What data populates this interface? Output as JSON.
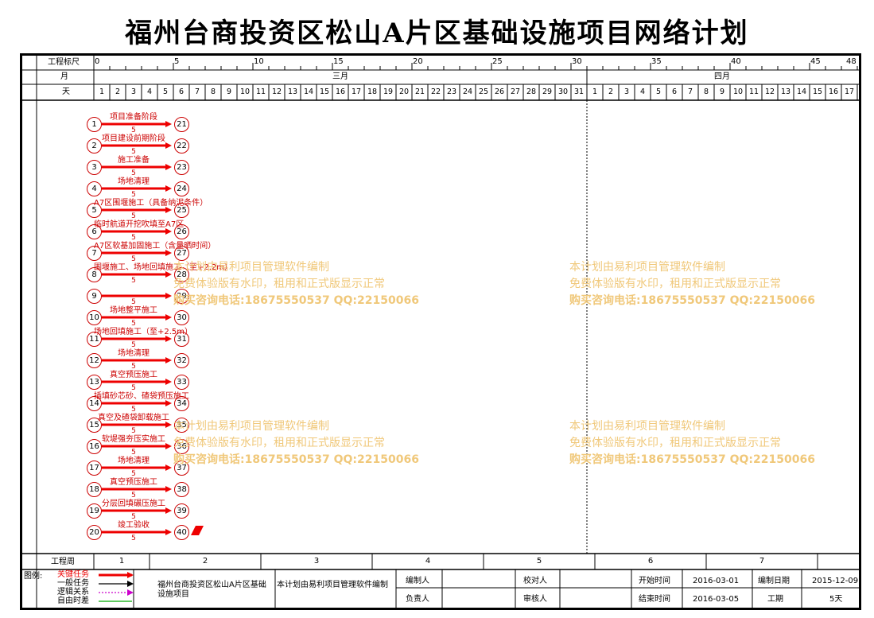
{
  "title": "福州台商投资区松山A片区基础设施项目网络计划",
  "header": {
    "ruler_label": "工程标尺",
    "month_label": "月",
    "day_label": "天",
    "ruler_ticks": [
      "0",
      "5",
      "10",
      "15",
      "20",
      "25",
      "30",
      "35",
      "40",
      "45",
      "48"
    ],
    "months": [
      "三月",
      "四月"
    ],
    "march_days": [
      "1",
      "2",
      "3",
      "4",
      "5",
      "6",
      "7",
      "8",
      "9",
      "10",
      "11",
      "12",
      "13",
      "14",
      "15",
      "16",
      "17",
      "18",
      "19",
      "20",
      "21",
      "22",
      "23",
      "24",
      "25",
      "26",
      "27",
      "28",
      "29",
      "30",
      "31"
    ],
    "april_days": [
      "1",
      "2",
      "3",
      "4",
      "5",
      "6",
      "7",
      "8",
      "9",
      "10",
      "11",
      "12",
      "13",
      "14",
      "15",
      "16",
      "17"
    ]
  },
  "tasks": [
    {
      "from": "1",
      "to": "21",
      "label": "项目准备阶段",
      "duration": "5"
    },
    {
      "from": "2",
      "to": "22",
      "label": "项目建设前期阶段",
      "duration": "5"
    },
    {
      "from": "3",
      "to": "23",
      "label": "施工准备",
      "duration": "5"
    },
    {
      "from": "4",
      "to": "24",
      "label": "场地清理",
      "duration": "5"
    },
    {
      "from": "5",
      "to": "25",
      "label": "A7区围堰施工（具备纳泥条件）",
      "duration": "5"
    },
    {
      "from": "6",
      "to": "26",
      "label": "临时航道开挖吹填至A7区",
      "duration": "5"
    },
    {
      "from": "7",
      "to": "27",
      "label": "A7区软基加固施工（含量晒时间）",
      "duration": "5"
    },
    {
      "from": "8",
      "to": "28",
      "label": "围堰施工、场地回填施工（至+2.2m）",
      "duration": "5"
    },
    {
      "from": "9",
      "to": "29",
      "label": "",
      "duration": "5"
    },
    {
      "from": "10",
      "to": "30",
      "label": "场地整平施工",
      "duration": "5"
    },
    {
      "from": "11",
      "to": "31",
      "label": "场地回填施工（至+2.5m）",
      "duration": "5"
    },
    {
      "from": "12",
      "to": "32",
      "label": "场地清理",
      "duration": "5"
    },
    {
      "from": "13",
      "to": "33",
      "label": "真空预压施工",
      "duration": "5"
    },
    {
      "from": "14",
      "to": "34",
      "label": "插填砂芯砂、碴袋预压施工",
      "duration": "5"
    },
    {
      "from": "15",
      "to": "35",
      "label": "真空及碴袋卸载施工",
      "duration": "5"
    },
    {
      "from": "16",
      "to": "36",
      "label": "软堤强夯压实施工",
      "duration": "5"
    },
    {
      "from": "17",
      "to": "37",
      "label": "场地清理",
      "duration": "5"
    },
    {
      "from": "18",
      "to": "38",
      "label": "真空预压施工",
      "duration": "5"
    },
    {
      "from": "19",
      "to": "39",
      "label": "分层回填碾压施工",
      "duration": "5"
    },
    {
      "from": "20",
      "to": "40",
      "label": "竣工验收",
      "duration": "5"
    }
  ],
  "watermark": {
    "line1": "本计划由易利项目管理软件编制",
    "line2": "免费体验版有水印，租用和正式版显示正常",
    "line3": "购买咨询电话:18675550537 QQ:22150066"
  },
  "footer": {
    "week_label": "工程周",
    "weeks": [
      "1",
      "2",
      "3",
      "4",
      "5",
      "6",
      "7"
    ],
    "legend_title": "图例:",
    "legend": [
      {
        "name": "关键任务",
        "color": "#ee0000"
      },
      {
        "name": "一般任务",
        "color": "#000000"
      },
      {
        "name": "逻辑关系",
        "color": "#cc00cc"
      },
      {
        "name": "自由时差",
        "color": "#00aa00"
      }
    ],
    "project_name": "福州台商投资区松山A片区基础设施项目",
    "software": "本计划由易利项目管理软件编制",
    "compiler_label": "编制人",
    "responsible_label": "负责人",
    "checker_label": "校对人",
    "reviewer_label": "审核人",
    "start_label": "开始时间",
    "start_value": "2016-03-01",
    "end_label": "结束时间",
    "end_value": "2016-03-05",
    "date_label": "编制日期",
    "date_value": "2015-12-09",
    "period_label": "工期",
    "period_value": "5天"
  }
}
